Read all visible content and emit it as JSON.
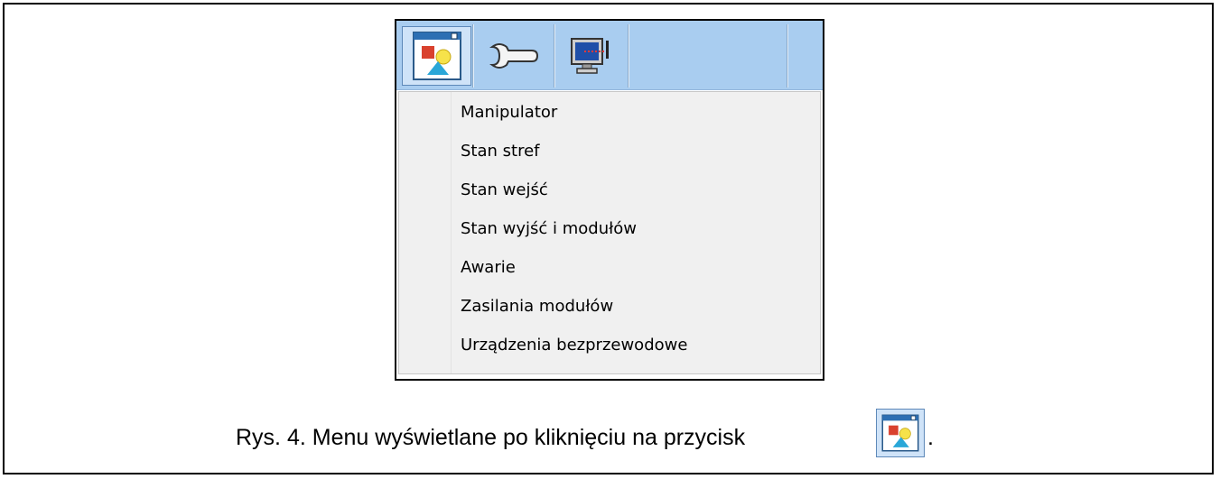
{
  "toolbar": {
    "buttons": [
      {
        "icon": "window-shapes-icon",
        "state": "active"
      },
      {
        "icon": "wrench-icon",
        "state": "normal"
      },
      {
        "icon": "monitor-icon",
        "state": "normal"
      }
    ],
    "colors": {
      "background": "#a9cdf0",
      "active_button": "#cfe3f8"
    }
  },
  "menu": {
    "items": [
      "Manipulator",
      "Stan stref",
      "Stan wejść",
      "Stan wyjść i modułów",
      "Awarie",
      "Zasilania modułów",
      "Urządzenia bezprzewodowe"
    ]
  },
  "caption": {
    "text": "Rys. 4. Menu wyświetlane po kliknięciu na przycisk",
    "icon": "window-shapes-icon",
    "end": "."
  }
}
